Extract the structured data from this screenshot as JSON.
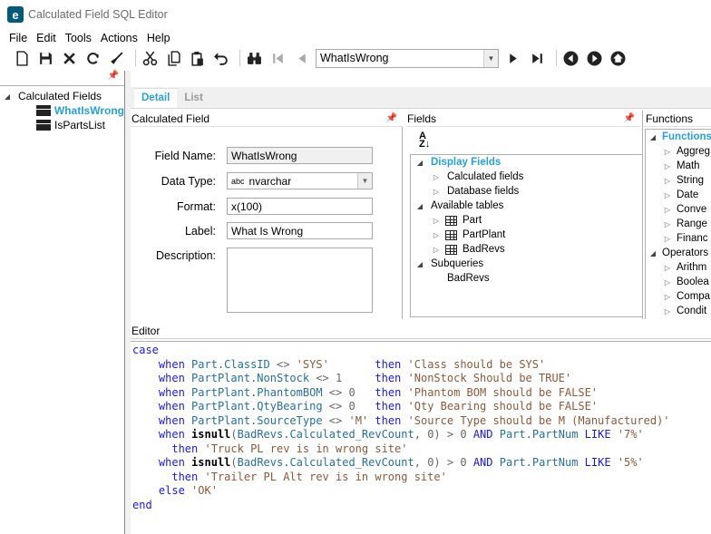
{
  "window": {
    "title": "Calculated Field SQL Editor"
  },
  "menu": [
    "File",
    "Edit",
    "Tools",
    "Actions",
    "Help"
  ],
  "toolbar": {
    "record_value": "WhatIsWrong"
  },
  "left_tree": {
    "root": "Calculated Fields",
    "items": [
      {
        "label": "WhatIsWrong",
        "selected": true
      },
      {
        "label": "IsPartsList",
        "selected": false
      }
    ]
  },
  "tabs": [
    {
      "label": "Detail",
      "active": true
    },
    {
      "label": "List",
      "active": false
    }
  ],
  "calc_panel": {
    "title": "Calculated Field",
    "field_name_label": "Field Name:",
    "field_name": "WhatIsWrong",
    "data_type_label": "Data Type:",
    "data_type_prefix": "abc",
    "data_type": "nvarchar",
    "format_label": "Format:",
    "format": "x(100)",
    "label_label": "Label:",
    "label": "What Is Wrong",
    "description_label": "Description:",
    "description": ""
  },
  "fields_panel": {
    "title": "Fields",
    "display_fields": "Display Fields",
    "calculated_fields": "Calculated fields",
    "database_fields": "Database fields",
    "available_tables": "Available tables",
    "tables": [
      "Part",
      "PartPlant",
      "BadRevs"
    ],
    "subqueries": "Subqueries",
    "subquery_items": [
      "BadRevs"
    ]
  },
  "functions_panel": {
    "title": "Functions",
    "root": "Functions",
    "items": [
      "Aggreg",
      "Math",
      "String",
      "Date",
      "Conve",
      "Range",
      "Financ"
    ],
    "operators": "Operators",
    "operator_items": [
      "Arithm",
      "Boolea",
      "Compa",
      "Condit"
    ]
  },
  "editor": {
    "title": "Editor",
    "lines": [
      "case",
      "    when Part.ClassID <> 'SYS'       then 'Class should be SYS'",
      "    when PartPlant.NonStock <> 1     then 'NonStock Should be TRUE'",
      "    when PartPlant.PhantomBOM <> 0   then 'Phantom BOM should be FALSE'",
      "    when PartPlant.QtyBearing <> 0   then 'Qty Bearing should be FALSE'",
      "    when PartPlant.SourceType <> 'M' then 'Source Type should be M (Manufactured)'",
      "    when isnull(BadRevs.Calculated_RevCount, 0) > 0 AND Part.PartNum LIKE '7%'",
      "      then 'Truck PL rev is in wrong site'",
      "    when isnull(BadRevs.Calculated_RevCount, 0) > 0 AND Part.PartNum LIKE '5%'",
      "      then 'Trailer PL Alt rev is in wrong site'",
      "    else 'OK'",
      "end"
    ]
  },
  "colors": {
    "accent": "#2aa0d0",
    "keyword": "#1a1ad8",
    "identifier": "#2a6f96",
    "string": "#8a5a3c"
  }
}
